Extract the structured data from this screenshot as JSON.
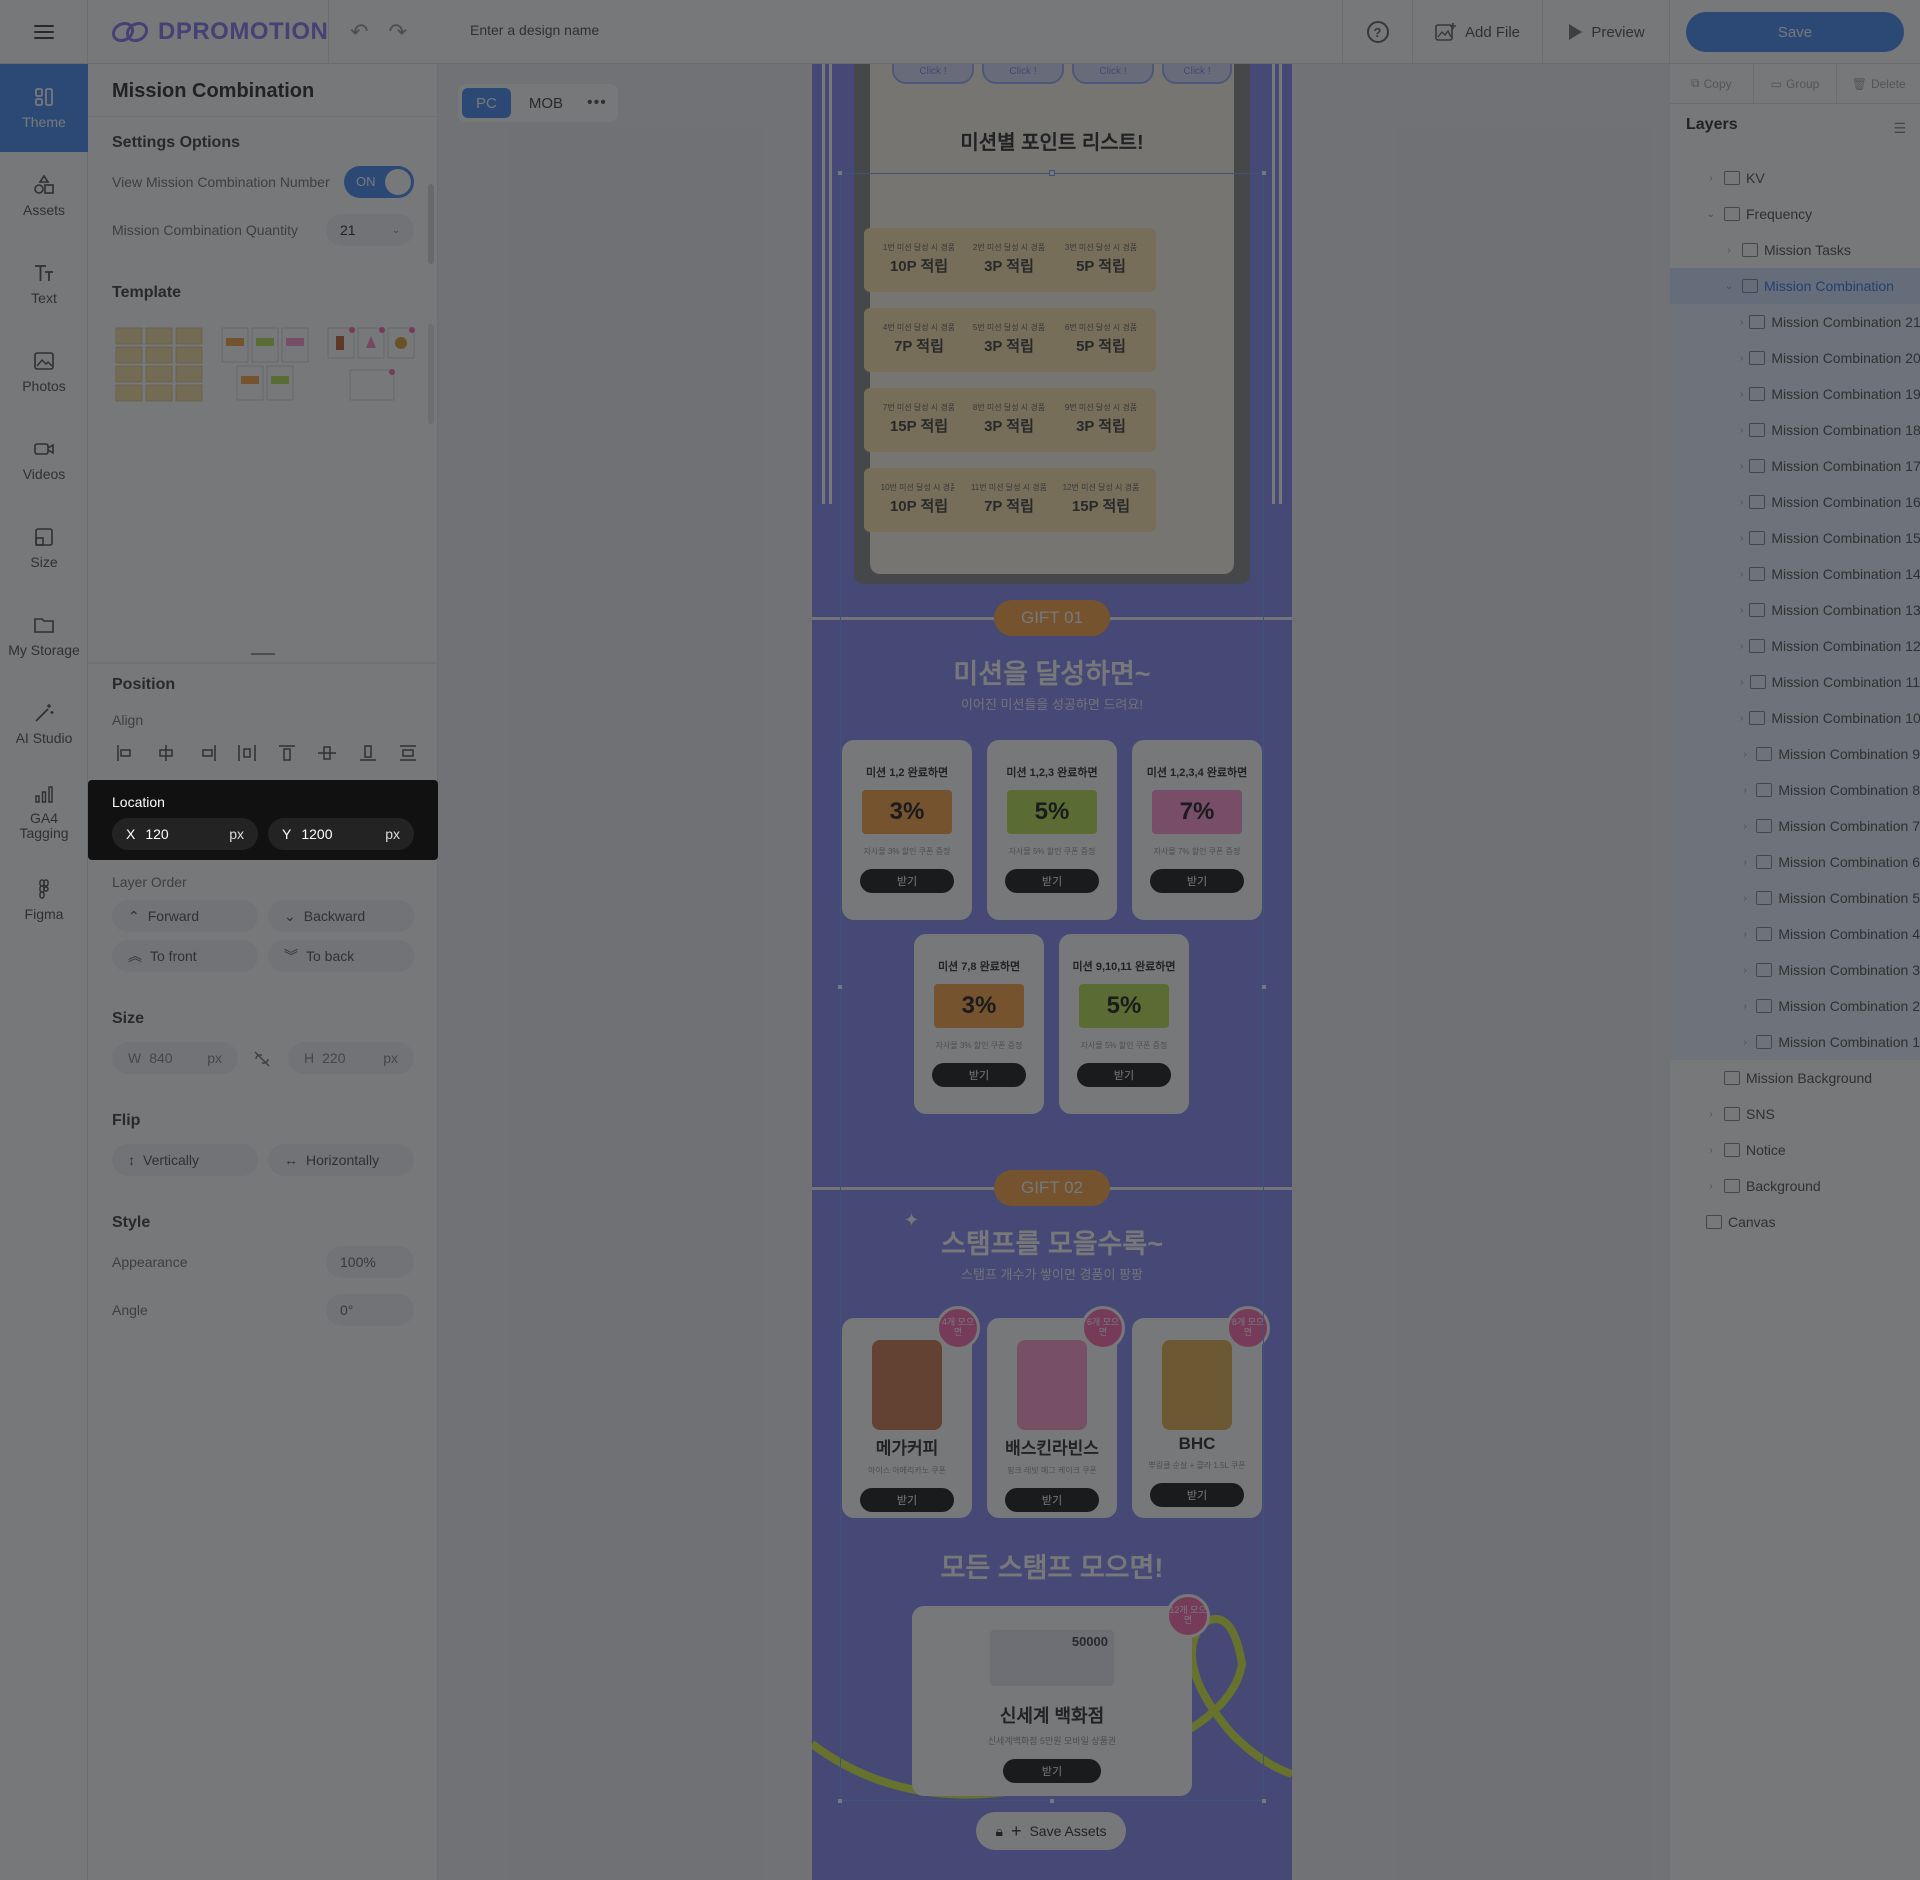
{
  "app": {
    "logo_text": "DPROMOTION",
    "design_name_placeholder": "Enter a design name"
  },
  "topbar": {
    "add_file": "Add File",
    "preview": "Preview",
    "save": "Save"
  },
  "rail": [
    {
      "label": "Theme",
      "icon": "theme-icon"
    },
    {
      "label": "Assets",
      "icon": "shapes-icon"
    },
    {
      "label": "Text",
      "icon": "text-icon"
    },
    {
      "label": "Photos",
      "icon": "image-icon"
    },
    {
      "label": "Videos",
      "icon": "video-icon"
    },
    {
      "label": "Size",
      "icon": "resize-icon"
    },
    {
      "label": "My Storage",
      "icon": "folder-icon"
    },
    {
      "label": "AI Studio",
      "icon": "magic-wand-icon"
    },
    {
      "label": "GA4 Tagging",
      "icon": "bar-chart-icon"
    },
    {
      "label": "Figma",
      "icon": "figma-icon"
    }
  ],
  "panel": {
    "title": "Mission Combination",
    "settings_title": "Settings Options",
    "view_number_label": "View Mission Combination Number",
    "toggle_state": "ON",
    "quantity_label": "Mission Combination Quantity",
    "quantity_value": "21",
    "template_title": "Template",
    "position_title": "Position",
    "align_label": "Align",
    "location_label": "Location",
    "x_axis": "X",
    "x_value": "120",
    "x_unit": "px",
    "y_axis": "Y",
    "y_value": "1200",
    "y_unit": "px",
    "layer_order_label": "Layer Order",
    "forward": "Forward",
    "backward": "Backward",
    "to_front": "To front",
    "to_back": "To back",
    "size_title": "Size",
    "w_label": "W",
    "w_value": "840",
    "w_unit": "px",
    "h_label": "H",
    "h_value": "220",
    "h_unit": "px",
    "flip_title": "Flip",
    "vertically": "Vertically",
    "horizontally": "Horizontally",
    "style_title": "Style",
    "appearance_label": "Appearance",
    "appearance_value": "100%",
    "angle_label": "Angle",
    "angle_value": "0°"
  },
  "canvas": {
    "view_pc": "PC",
    "view_mob": "MOB",
    "mission_list_title": "미션별 포인트 리스트!",
    "click_chip": "Click !",
    "cells": [
      {
        "top": "1번 미션 달성 시 경품",
        "main": "10P 적립"
      },
      {
        "top": "2번 미션 달성 시 경품",
        "main": "3P 적립"
      },
      {
        "top": "3번 미션 달성 시 경품",
        "main": "5P 적립"
      },
      {
        "top": "4번 미션 달성 시 경품",
        "main": "7P 적립"
      },
      {
        "top": "5번 미션 달성 시 경품",
        "main": "3P 적립"
      },
      {
        "top": "6번 미션 달성 시 경품",
        "main": "5P 적립"
      },
      {
        "top": "7번 미션 달성 시 경품",
        "main": "15P 적립"
      },
      {
        "top": "8번 미션 달성 시 경품",
        "main": "3P 적립"
      },
      {
        "top": "9번 미션 달성 시 경품",
        "main": "3P 적립"
      },
      {
        "top": "10번 미션 달성 시 경품",
        "main": "10P 적립"
      },
      {
        "top": "11번 미션 달성 시 경품",
        "main": "7P 적립"
      },
      {
        "top": "12번 미션 달성 시 경품",
        "main": "15P 적립"
      }
    ],
    "gift1_tag": "GIFT 01",
    "gift1_head": "미션을 달성하면~",
    "gift1_sub": "이어진 미션들을 성공하면 드려요!",
    "coupons": [
      {
        "title": "미션 1,2 완료하면",
        "value": "3%",
        "desc": "자사몰 3% 할인 쿠폰 증정",
        "color": "#f7a74a",
        "btn": "받기"
      },
      {
        "title": "미션 1,2,3 완료하면",
        "value": "5%",
        "desc": "자사몰 5% 할인 쿠폰 증정",
        "color": "#b9e35a",
        "btn": "받기"
      },
      {
        "title": "미션 1,2,3,4 완료하면",
        "value": "7%",
        "desc": "자사몰 7% 할인 쿠폰 증정",
        "color": "#ff9ad4",
        "btn": "받기"
      },
      {
        "title": "미션 7,8 완료하면",
        "value": "3%",
        "desc": "자사몰 3% 할인 쿠폰 증정",
        "color": "#f7a74a",
        "btn": "받기"
      },
      {
        "title": "미션 9,10,11 완료하면",
        "value": "5%",
        "desc": "자사몰 5% 할인 쿠폰 증정",
        "color": "#b9e35a",
        "btn": "받기"
      }
    ],
    "gift2_tag": "GIFT 02",
    "gift2_head": "스탬프를 모을수록~",
    "gift2_sub": "스탬프 개수가 쌓이면 경품이 팡팡",
    "stamps": [
      {
        "badge": "4개 모으면",
        "name": "메가커피",
        "desc": "아이스 아메리카노 쿠폰",
        "color": "#c7663a",
        "btn": "받기"
      },
      {
        "badge": "6개 모으면",
        "name": "배스킨라빈스",
        "desc": "핑크 레빗 메그 케이크 쿠폰",
        "color": "#ff8fc4",
        "btn": "받기"
      },
      {
        "badge": "8개 모으면",
        "name": "BHC",
        "desc": "뿌링클 순살 + 콜라 1.5L 쿠폰",
        "color": "#e0a53a",
        "btn": "받기"
      }
    ],
    "final_head": "모든 스탬프 모으면!",
    "final_badge": "12개 모으면",
    "final_card_amount": "50000",
    "final_name": "신세계 백화점",
    "final_desc": "신세계백화점 5만원 모바일 상품권",
    "final_btn": "받기",
    "save_assets": "Save Assets"
  },
  "right": {
    "copy": "Copy",
    "group": "Group",
    "delete": "Delete",
    "layers_title": "Layers",
    "layers": [
      {
        "label": "KV",
        "indent": 1,
        "caret": "›",
        "state": ""
      },
      {
        "label": "Frequency",
        "indent": 1,
        "caret": "⌄",
        "state": ""
      },
      {
        "label": "Mission Tasks",
        "indent": 2,
        "caret": "›",
        "state": ""
      },
      {
        "label": "Mission Combination",
        "indent": 2,
        "caret": "⌄",
        "state": "sel"
      },
      {
        "label": "Mission Combination 21",
        "indent": 3,
        "caret": "›",
        "state": "child"
      },
      {
        "label": "Mission Combination 20",
        "indent": 3,
        "caret": "›",
        "state": "child"
      },
      {
        "label": "Mission Combination 19",
        "indent": 3,
        "caret": "›",
        "state": "child"
      },
      {
        "label": "Mission Combination 18",
        "indent": 3,
        "caret": "›",
        "state": "child"
      },
      {
        "label": "Mission Combination 17",
        "indent": 3,
        "caret": "›",
        "state": "child"
      },
      {
        "label": "Mission Combination 16",
        "indent": 3,
        "caret": "›",
        "state": "child"
      },
      {
        "label": "Mission Combination 15",
        "indent": 3,
        "caret": "›",
        "state": "child"
      },
      {
        "label": "Mission Combination 14",
        "indent": 3,
        "caret": "›",
        "state": "child"
      },
      {
        "label": "Mission Combination 13",
        "indent": 3,
        "caret": "›",
        "state": "child"
      },
      {
        "label": "Mission Combination 12",
        "indent": 3,
        "caret": "›",
        "state": "child"
      },
      {
        "label": "Mission Combination 11",
        "indent": 3,
        "caret": "›",
        "state": "child"
      },
      {
        "label": "Mission Combination 10",
        "indent": 3,
        "caret": "›",
        "state": "child"
      },
      {
        "label": "Mission Combination 9",
        "indent": 3,
        "caret": "›",
        "state": "child"
      },
      {
        "label": "Mission Combination 8",
        "indent": 3,
        "caret": "›",
        "state": "child"
      },
      {
        "label": "Mission Combination 7",
        "indent": 3,
        "caret": "›",
        "state": "child"
      },
      {
        "label": "Mission Combination 6",
        "indent": 3,
        "caret": "›",
        "state": "child"
      },
      {
        "label": "Mission Combination 5",
        "indent": 3,
        "caret": "›",
        "state": "child"
      },
      {
        "label": "Mission Combination 4",
        "indent": 3,
        "caret": "›",
        "state": "child"
      },
      {
        "label": "Mission Combination 3",
        "indent": 3,
        "caret": "›",
        "state": "child"
      },
      {
        "label": "Mission Combination 2",
        "indent": 3,
        "caret": "›",
        "state": "child"
      },
      {
        "label": "Mission Combination 1",
        "indent": 3,
        "caret": "›",
        "state": "child"
      },
      {
        "label": "Mission Background",
        "indent": 1,
        "caret": "",
        "state": ""
      },
      {
        "label": "SNS",
        "indent": 1,
        "caret": "›",
        "state": ""
      },
      {
        "label": "Notice",
        "indent": 1,
        "caret": "›",
        "state": ""
      },
      {
        "label": "Background",
        "indent": 1,
        "caret": "›",
        "state": ""
      },
      {
        "label": "Canvas",
        "indent": 0,
        "caret": "",
        "state": ""
      }
    ]
  }
}
